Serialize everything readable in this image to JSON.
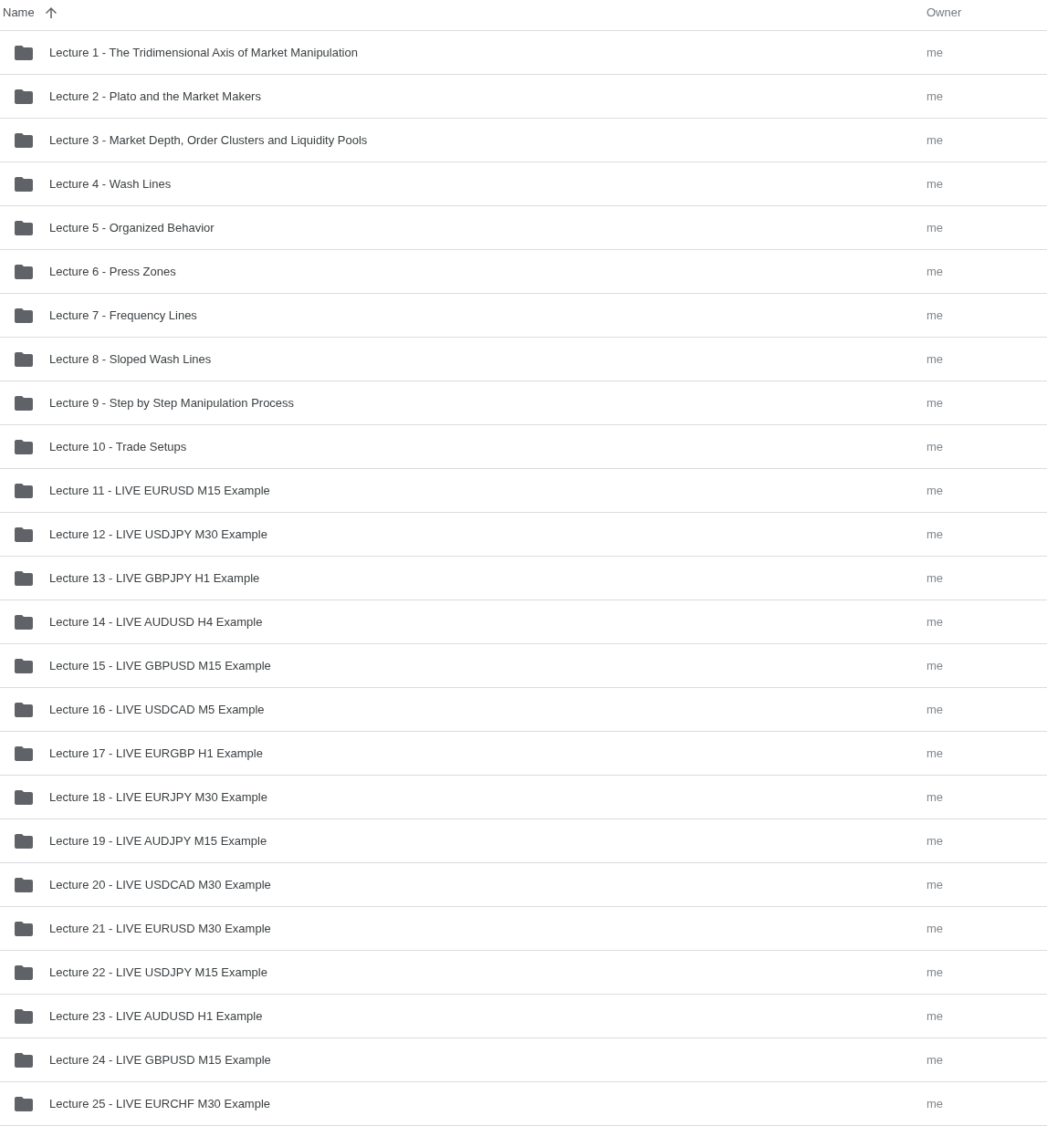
{
  "columns": [
    {
      "label": "Name",
      "sorted": true,
      "ascending": true
    },
    {
      "label": "Owner",
      "sorted": false
    }
  ],
  "rows": [
    {
      "name": "Lecture 1 - The Tridimensional Axis of Market Manipulation",
      "owner": "me"
    },
    {
      "name": "Lecture 2 - Plato and the Market Makers",
      "owner": "me"
    },
    {
      "name": "Lecture 3 - Market Depth, Order Clusters and Liquidity Pools",
      "owner": "me"
    },
    {
      "name": "Lecture 4 - Wash Lines",
      "owner": "me"
    },
    {
      "name": "Lecture 5 - Organized Behavior",
      "owner": "me"
    },
    {
      "name": "Lecture 6 - Press Zones",
      "owner": "me"
    },
    {
      "name": "Lecture 7 - Frequency Lines",
      "owner": "me"
    },
    {
      "name": "Lecture 8 - Sloped Wash Lines",
      "owner": "me"
    },
    {
      "name": "Lecture 9 - Step by Step Manipulation Process",
      "owner": "me"
    },
    {
      "name": "Lecture 10 - Trade Setups",
      "owner": "me"
    },
    {
      "name": "Lecture 11 - LIVE EURUSD M15 Example",
      "owner": "me"
    },
    {
      "name": "Lecture 12 - LIVE USDJPY M30 Example",
      "owner": "me"
    },
    {
      "name": "Lecture 13 - LIVE GBPJPY H1 Example",
      "owner": "me"
    },
    {
      "name": "Lecture 14 - LIVE AUDUSD H4 Example",
      "owner": "me"
    },
    {
      "name": "Lecture 15 - LIVE GBPUSD M15 Example",
      "owner": "me"
    },
    {
      "name": "Lecture 16 - LIVE USDCAD M5 Example",
      "owner": "me"
    },
    {
      "name": "Lecture 17 - LIVE EURGBP H1 Example",
      "owner": "me"
    },
    {
      "name": "Lecture 18 - LIVE EURJPY M30 Example",
      "owner": "me"
    },
    {
      "name": "Lecture 19 - LIVE AUDJPY M15 Example",
      "owner": "me"
    },
    {
      "name": "Lecture 20 - LIVE USDCAD M30 Example",
      "owner": "me"
    },
    {
      "name": "Lecture 21 - LIVE EURUSD M30 Example",
      "owner": "me"
    },
    {
      "name": "Lecture 22 - LIVE USDJPY M15 Example",
      "owner": "me"
    },
    {
      "name": "Lecture 23 - LIVE AUDUSD H1 Example",
      "owner": "me"
    },
    {
      "name": "Lecture 24 - LIVE GBPUSD M15 Example",
      "owner": "me"
    },
    {
      "name": "Lecture 25 - LIVE EURCHF M30 Example",
      "owner": "me"
    }
  ]
}
